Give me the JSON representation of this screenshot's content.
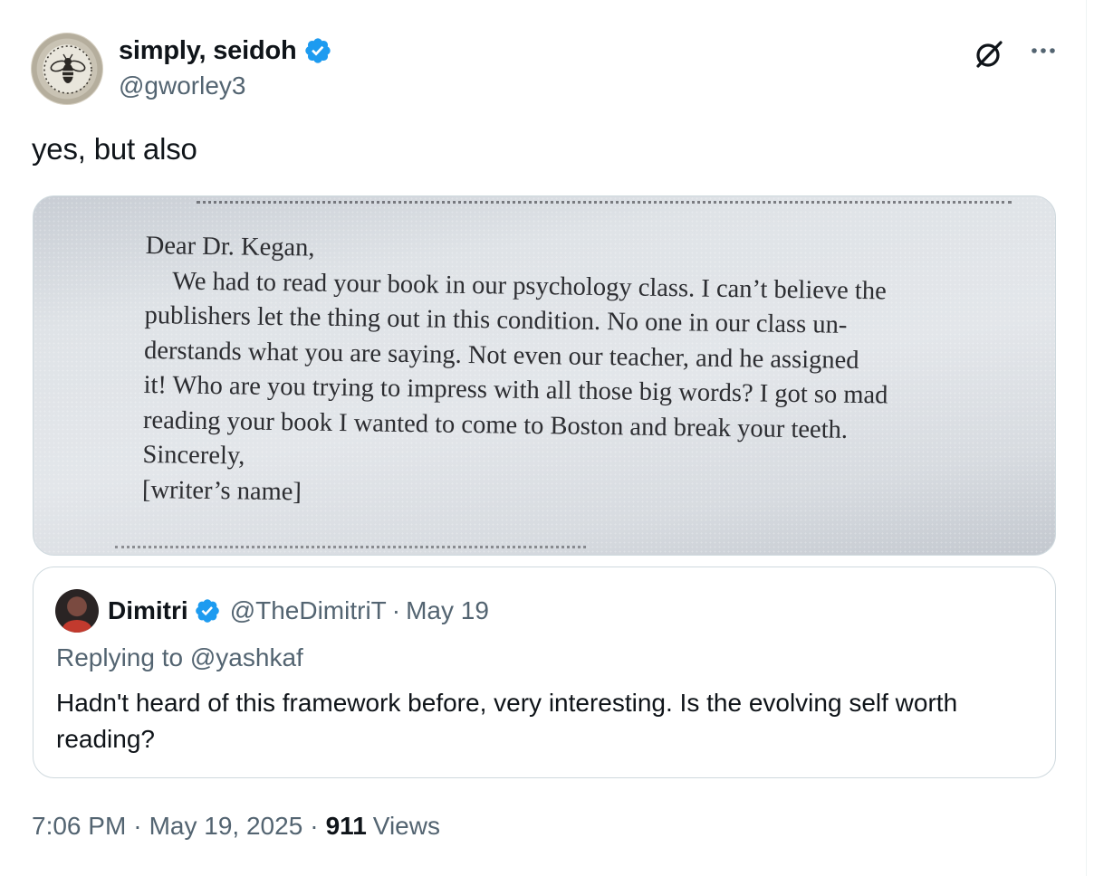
{
  "author": {
    "display_name": "simply, seidoh",
    "handle": "@gworley3",
    "verified": true
  },
  "tweet": {
    "text": "yes, but also"
  },
  "media": {
    "letter_lines": [
      "Dear Dr. Kegan,",
      "We had to read your book in our psychology class. I can’t believe the",
      "publishers let the thing out in this condition. No one in our class un-",
      "derstands what you are saying. Not even our teacher, and he assigned",
      "it! Who are you trying to impress with all those big words? I got so mad",
      "reading your book I wanted to come to Boston and break your teeth.",
      "Sincerely,",
      "[writer’s name]"
    ]
  },
  "quoted_tweet": {
    "display_name": "Dimitri",
    "handle": "@TheDimitriT",
    "separator": "·",
    "date": "May 19",
    "replying_prefix": "Replying to",
    "replying_to": "@yashkaf",
    "text": "Hadn't heard of this framework before, very interesting. Is the evolving self worth reading?"
  },
  "meta": {
    "time": "7:06 PM",
    "separator": "·",
    "date": "May 19, 2025",
    "views_count": "911",
    "views_label": "Views"
  },
  "icons": {
    "verified": "verified-badge-icon",
    "grok": "grok-icon",
    "more": "more-icon"
  },
  "colors": {
    "verified_blue": "#1d9bf0",
    "secondary_text": "#536471",
    "primary_text": "#0f1419",
    "border": "#cfd9de"
  }
}
